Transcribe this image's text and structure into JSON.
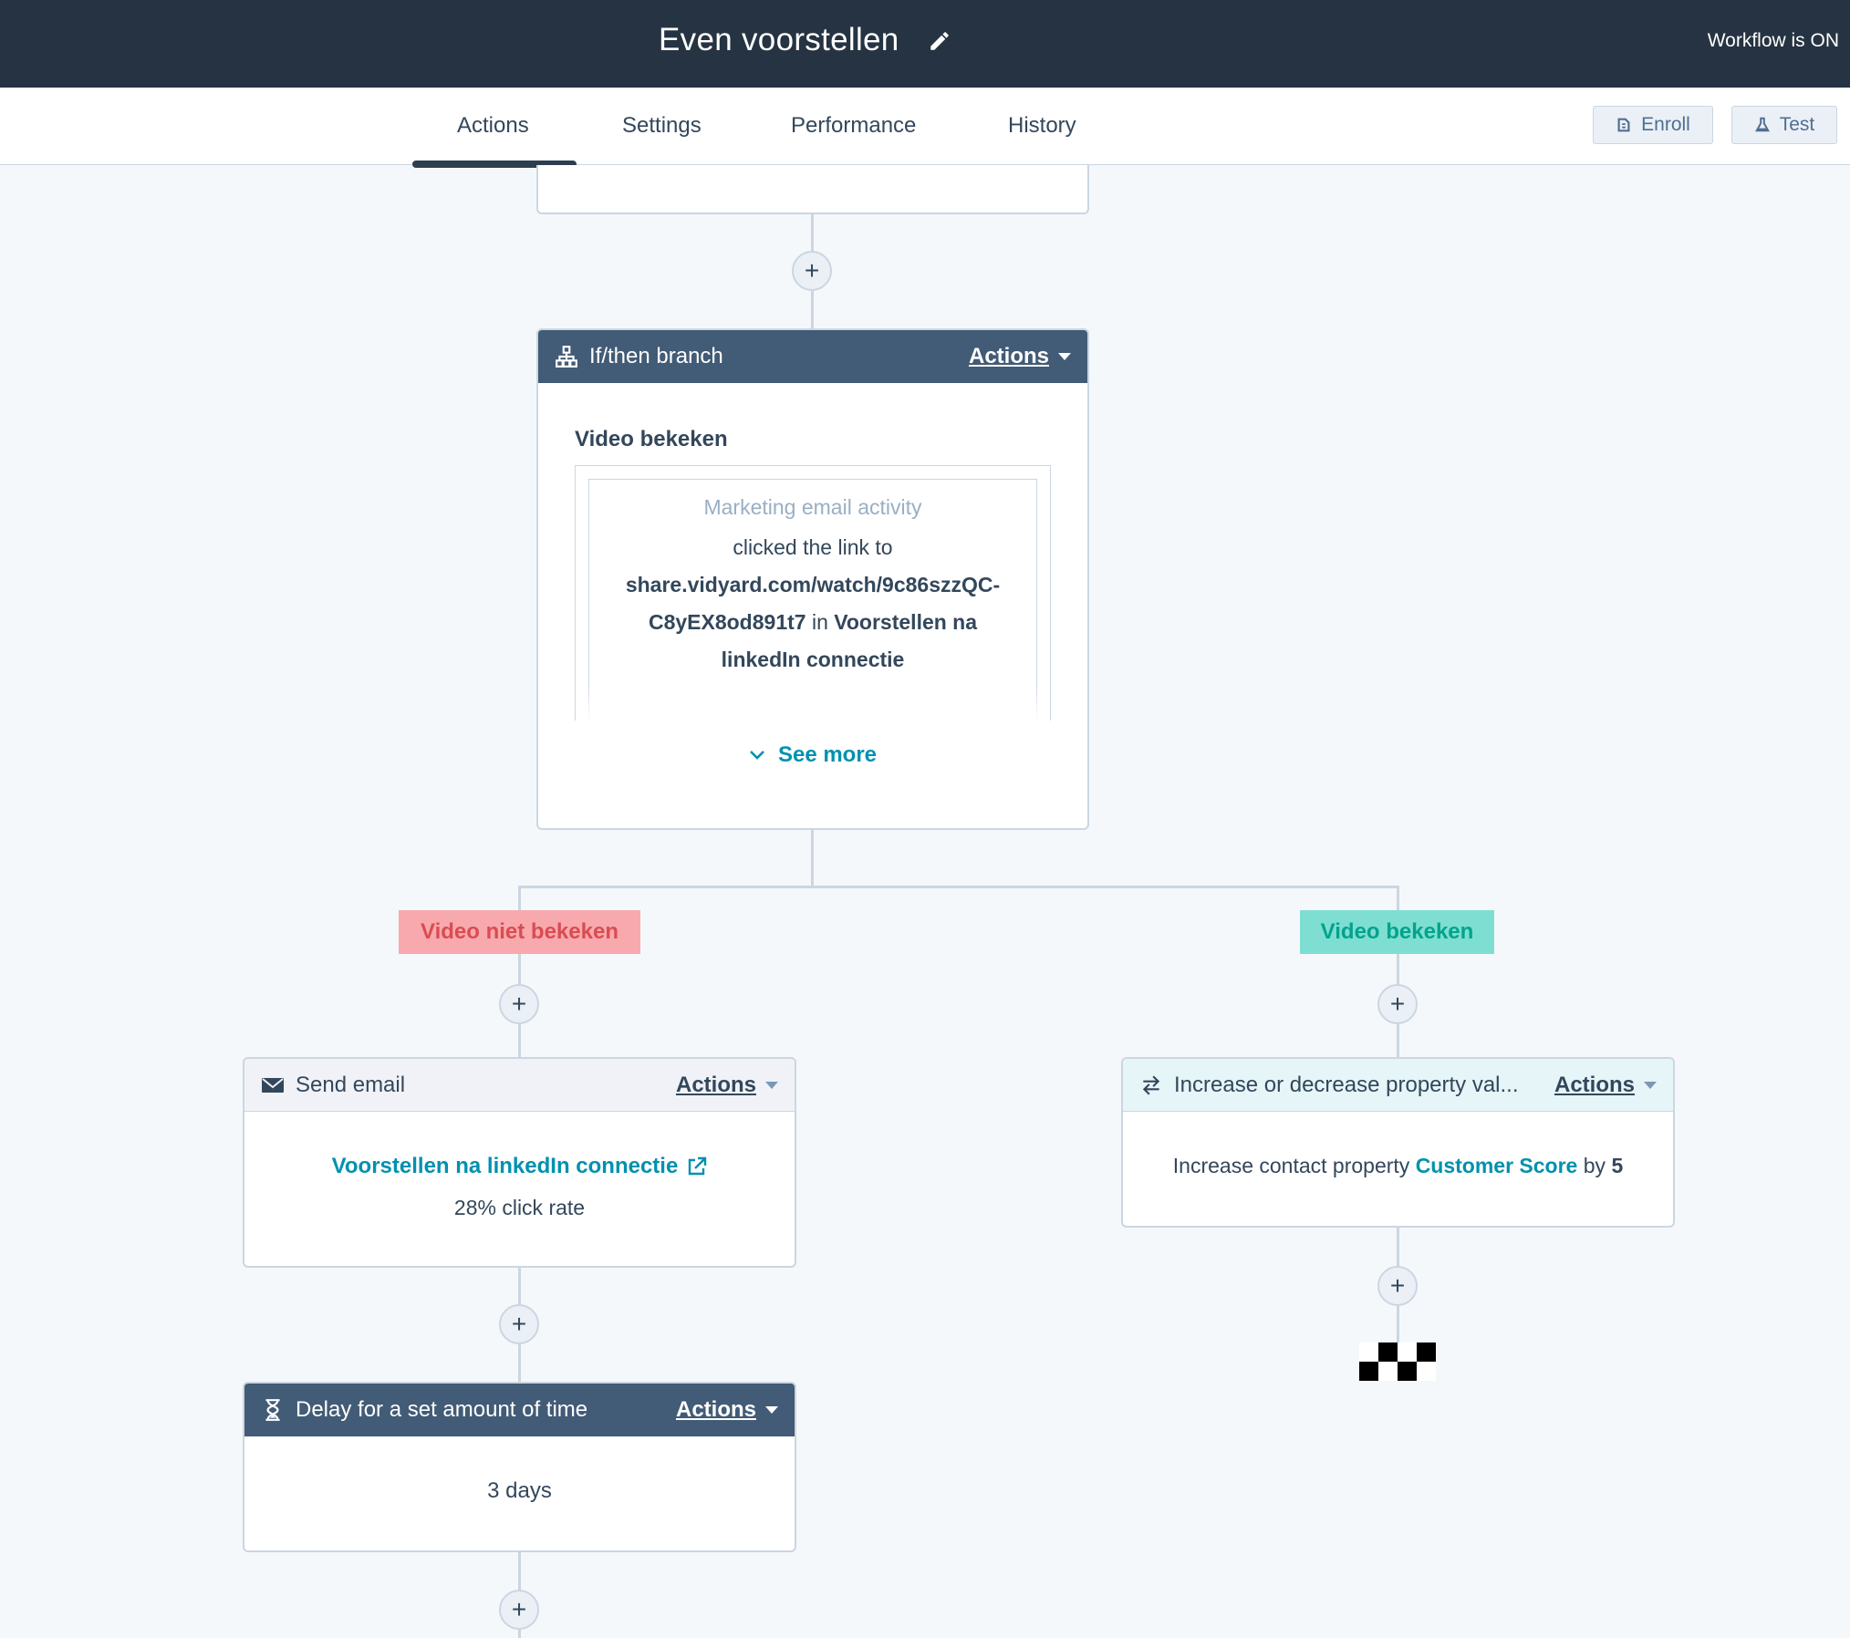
{
  "header": {
    "title": "Even voorstellen",
    "status": "Workflow is ON"
  },
  "tabs": [
    {
      "label": "Actions",
      "active": true
    },
    {
      "label": "Settings"
    },
    {
      "label": "Performance"
    },
    {
      "label": "History"
    }
  ],
  "toolbar": {
    "enroll_label": "Enroll",
    "test_label": "Test"
  },
  "branch_card": {
    "title": "If/then branch",
    "actions_label": "Actions",
    "condition_title": "Video bekeken",
    "filter_category": "Marketing email activity",
    "filter_text_1": "clicked the link to",
    "filter_link_part1": "share.vidyard.com/watch/9c86szzQC-",
    "filter_link_part2": "C8yEX8od891t7",
    "filter_in": "in",
    "filter_email_1": "Voorstellen na",
    "filter_email_2": "linkedIn connectie",
    "see_more": "See more"
  },
  "branches": {
    "left_label": "Video niet bekeken",
    "right_label": "Video bekeken"
  },
  "send_email_card": {
    "title": "Send email",
    "actions_label": "Actions",
    "email_name": "Voorstellen na linkedIn connectie",
    "click_rate": "28% click rate"
  },
  "property_card": {
    "title": "Increase or decrease property val...",
    "actions_label": "Actions",
    "text_prefix": "Increase contact property",
    "property_name": "Customer Score",
    "text_by": "by",
    "amount": "5"
  },
  "delay_card": {
    "title": "Delay for a set amount of time",
    "actions_label": "Actions",
    "duration": "3 days"
  },
  "colors": {
    "header_bg": "#253342",
    "card_header_dark": "#425b76",
    "link_teal": "#0091ae",
    "branch_no_bg": "#f8a9ad",
    "branch_yes_bg": "#7fded2"
  }
}
